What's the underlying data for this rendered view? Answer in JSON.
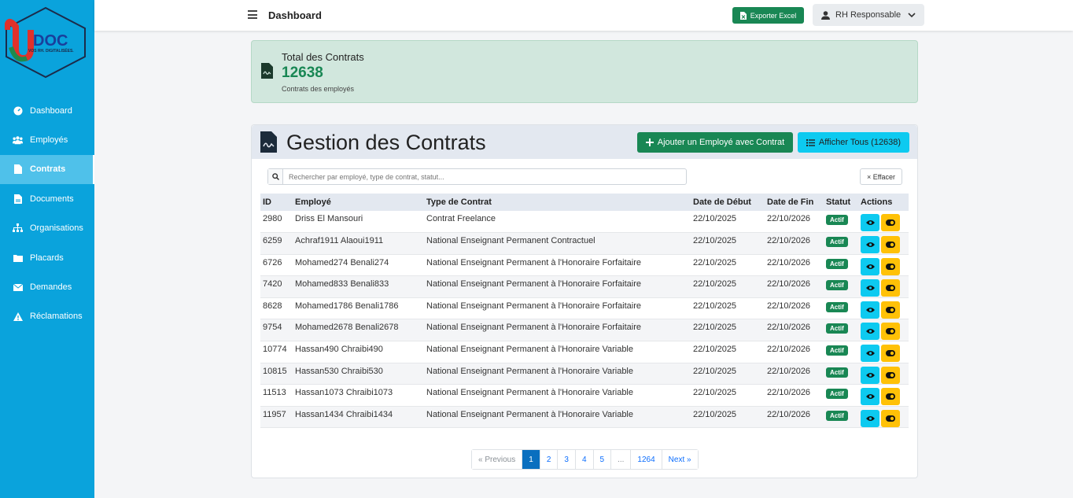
{
  "brand": {
    "logo_text": "DOC",
    "logo_tagline": "VOS RH. DIGITALISÉES.",
    "color": "#0aa3dc"
  },
  "sidebar": {
    "items": [
      {
        "label": "Dashboard",
        "icon": "gauge-icon"
      },
      {
        "label": "Employés",
        "icon": "users-icon"
      },
      {
        "label": "Contrats",
        "icon": "file-icon",
        "active": true
      },
      {
        "label": "Documents",
        "icon": "file-icon"
      },
      {
        "label": "Organisations",
        "icon": "sitemap-icon"
      },
      {
        "label": "Placards",
        "icon": "folder-icon"
      },
      {
        "label": "Demandes",
        "icon": "envelope-icon"
      },
      {
        "label": "Réclamations",
        "icon": "warning-icon"
      }
    ]
  },
  "header": {
    "title": "Dashboard",
    "export_label": "Exporter Excel",
    "user_label": "RH Responsable"
  },
  "stat": {
    "title": "Total des Contrats",
    "value": "12638",
    "subtitle": "Contrats des employés"
  },
  "contracts": {
    "title": "Gestion des Contrats",
    "add_label": "Ajouter un Employé avec Contrat",
    "show_all_label": "Afficher Tous (12638)",
    "search_placeholder": "Rechercher par employé, type de contrat, statut...",
    "clear_label": "× Effacer",
    "columns": [
      "ID",
      "Employé",
      "Type de Contrat",
      "Date de Début",
      "Date de Fin",
      "Statut",
      "Actions"
    ],
    "rows": [
      {
        "id": "2980",
        "employee": "Driss El Mansouri",
        "type": "Contrat Freelance",
        "start": "22/10/2025",
        "end": "22/10/2026",
        "status": "Actif"
      },
      {
        "id": "6259",
        "employee": "Achraf1911 Alaoui1911",
        "type": "National Enseignant Permanent Contractuel",
        "start": "22/10/2025",
        "end": "22/10/2026",
        "status": "Actif"
      },
      {
        "id": "6726",
        "employee": "Mohamed274 Benali274",
        "type": "National Enseignant Permanent à l'Honoraire Forfaitaire",
        "start": "22/10/2025",
        "end": "22/10/2026",
        "status": "Actif"
      },
      {
        "id": "7420",
        "employee": "Mohamed833 Benali833",
        "type": "National Enseignant Permanent à l'Honoraire Forfaitaire",
        "start": "22/10/2025",
        "end": "22/10/2026",
        "status": "Actif"
      },
      {
        "id": "8628",
        "employee": "Mohamed1786 Benali1786",
        "type": "National Enseignant Permanent à l'Honoraire Forfaitaire",
        "start": "22/10/2025",
        "end": "22/10/2026",
        "status": "Actif"
      },
      {
        "id": "9754",
        "employee": "Mohamed2678 Benali2678",
        "type": "National Enseignant Permanent à l'Honoraire Forfaitaire",
        "start": "22/10/2025",
        "end": "22/10/2026",
        "status": "Actif"
      },
      {
        "id": "10774",
        "employee": "Hassan490 Chraibi490",
        "type": "National Enseignant Permanent à l'Honoraire Variable",
        "start": "22/10/2025",
        "end": "22/10/2026",
        "status": "Actif"
      },
      {
        "id": "10815",
        "employee": "Hassan530 Chraibi530",
        "type": "National Enseignant Permanent à l'Honoraire Variable",
        "start": "22/10/2025",
        "end": "22/10/2026",
        "status": "Actif"
      },
      {
        "id": "11513",
        "employee": "Hassan1073 Chraibi1073",
        "type": "National Enseignant Permanent à l'Honoraire Variable",
        "start": "22/10/2025",
        "end": "22/10/2026",
        "status": "Actif"
      },
      {
        "id": "11957",
        "employee": "Hassan1434 Chraibi1434",
        "type": "National Enseignant Permanent à l'Honoraire Variable",
        "start": "22/10/2025",
        "end": "22/10/2026",
        "status": "Actif"
      }
    ]
  },
  "pagination": {
    "previous": "« Previous",
    "pages": [
      "1",
      "2",
      "3",
      "4",
      "5",
      "...",
      "1264"
    ],
    "current": "1",
    "next": "Next »"
  },
  "colors": {
    "success": "#198754",
    "info": "#0dcaf0",
    "warning": "#ffc107",
    "stat_bg": "#d1e7dd"
  }
}
